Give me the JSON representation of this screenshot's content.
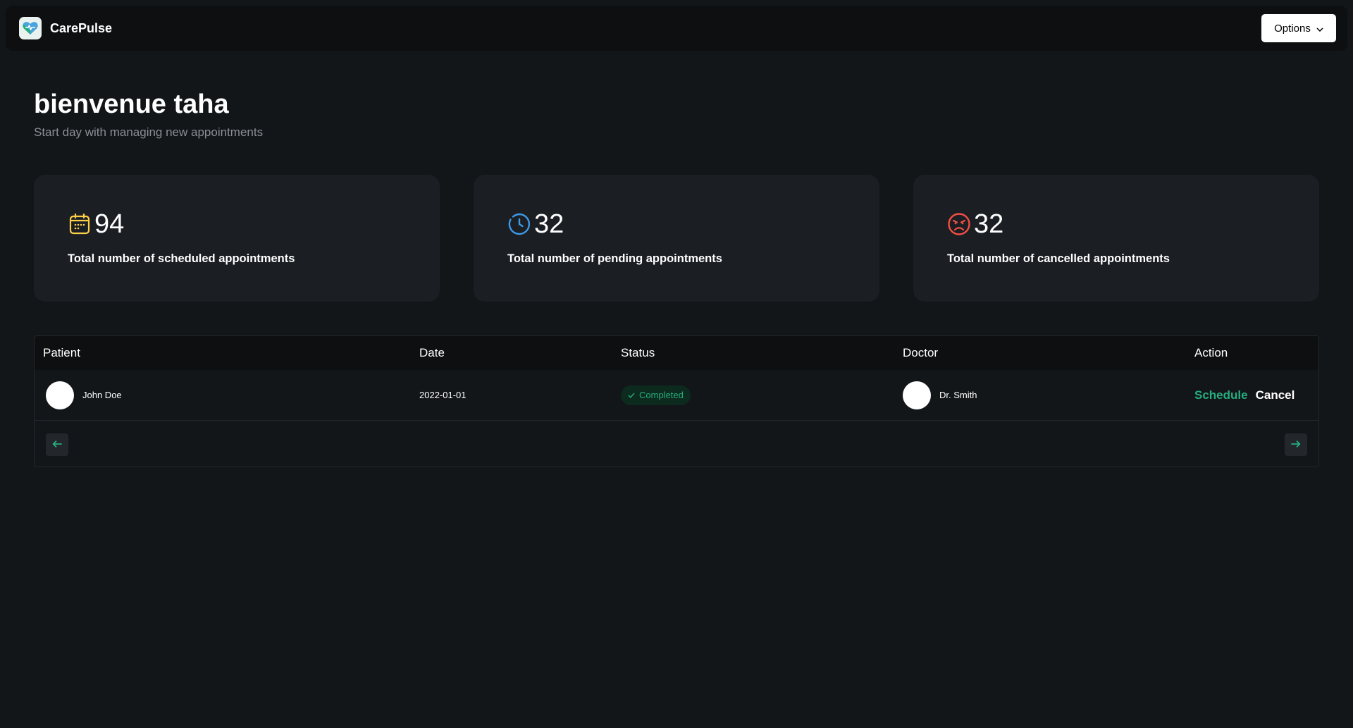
{
  "header": {
    "brand_name": "CarePulse",
    "options_label": "Options"
  },
  "welcome": {
    "title": "bienvenue taha",
    "subtitle": "Start day with managing new appointments"
  },
  "stats": [
    {
      "count": "94",
      "label": "Total number of scheduled appointments",
      "icon": "calendar-icon",
      "color": "#ffd147"
    },
    {
      "count": "32",
      "label": "Total number of pending appointments",
      "icon": "clock-icon",
      "color": "#3d9ae8"
    },
    {
      "count": "32",
      "label": "Total number of cancelled appointments",
      "icon": "angry-face-icon",
      "color": "#f24e43"
    }
  ],
  "table": {
    "columns": [
      "Patient",
      "Date",
      "Status",
      "Doctor",
      "Action"
    ],
    "rows": [
      {
        "patient": "John Doe",
        "date": "2022-01-01",
        "status": "Completed",
        "doctor": "Dr. Smith",
        "action_schedule": "Schedule",
        "action_cancel": "Cancel"
      }
    ]
  },
  "colors": {
    "background": "#131619",
    "accent_green": "#24ae7c",
    "card": "#1b1e23"
  }
}
